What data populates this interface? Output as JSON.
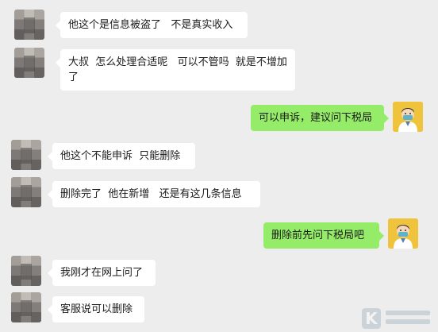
{
  "messages": [
    {
      "from": "other",
      "text": "他这个是信息被盗了   不是真实收入"
    },
    {
      "from": "other",
      "text": "大叔  怎么处理合适呢   可以不管吗  就是不增加了"
    },
    {
      "from": "me",
      "text": "可以申诉，建议问下税局"
    },
    {
      "from": "other",
      "text": "他这个不能申诉  只能删除"
    },
    {
      "from": "other",
      "text": "删除完了  他在新增   还是有这几条信息"
    },
    {
      "from": "me",
      "text": "删除前先问下税局吧"
    },
    {
      "from": "other",
      "text": "我刚才在网上问了"
    },
    {
      "from": "other",
      "text": "客服说可以删除"
    }
  ],
  "colors": {
    "background": "#ededed",
    "incoming_bubble": "#ffffff",
    "outgoing_bubble": "#95ec69"
  },
  "icons": {
    "other_avatar": "pixelated-avatar-icon",
    "my_avatar": "doctor-avatar-icon",
    "watermark": "k-logo-icon"
  }
}
